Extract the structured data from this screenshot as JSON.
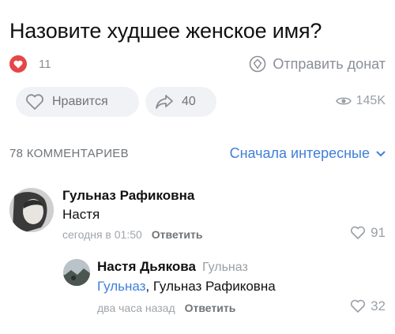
{
  "post": {
    "title": "Назовите худшее женское имя?",
    "reaction_count": "11",
    "donate_label": "Отправить донат",
    "like_label": "Нравится",
    "share_count": "40",
    "views": "145K"
  },
  "comments_header": {
    "count_label": "78 КОММЕНТАРИЕВ",
    "sort_label": "Сначала интересные"
  },
  "comments": [
    {
      "author": "Гульназ Рафиковна",
      "text": "Настя",
      "time": "сегодня в 01:50",
      "reply_label": "Ответить",
      "likes": "91"
    },
    {
      "author": "Настя Дьякова",
      "reply_to": "Гульназ",
      "mention": "Гульназ",
      "text": ", Гульназ Рафиковна",
      "time": "два часа назад",
      "reply_label": "Ответить",
      "likes": "32"
    }
  ],
  "colors": {
    "accent": "#3f7fd9",
    "reaction": "#e64646",
    "muted": "#9aa0a6"
  }
}
